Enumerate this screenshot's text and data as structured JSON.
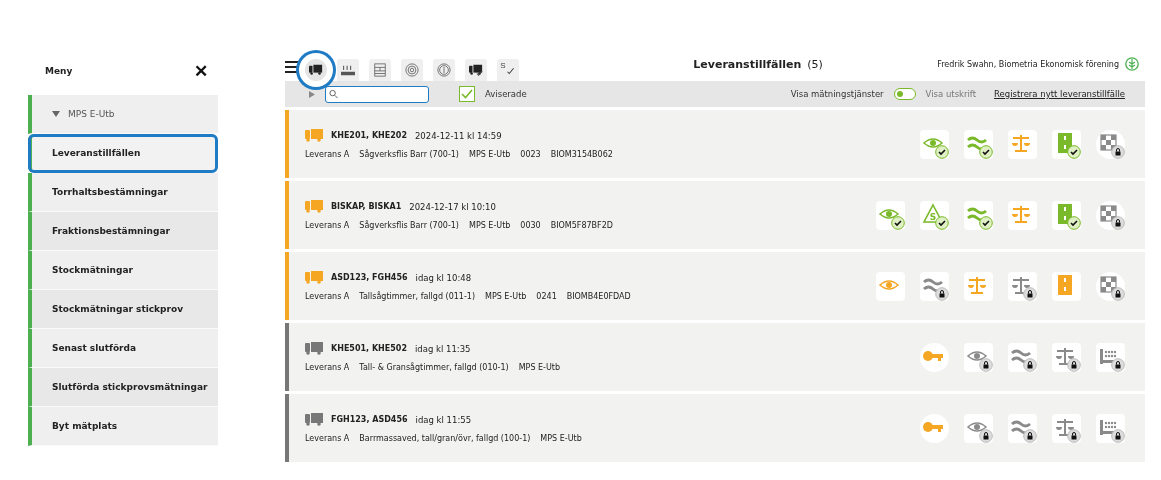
{
  "sidebar": {
    "title": "Meny",
    "close": "✕",
    "items": [
      {
        "label": "MPS E-Utb",
        "kind": "group",
        "expanded": true,
        "selected": false
      },
      {
        "label": "Leveranstillfällen",
        "kind": "link",
        "selected": true
      },
      {
        "label": "Torrhaltsbestämningar",
        "kind": "link",
        "selected": false
      },
      {
        "label": "Fraktionsbestämningar",
        "kind": "link",
        "selected": false
      },
      {
        "label": "Stockmätningar",
        "kind": "link",
        "selected": false
      },
      {
        "label": "Stockmätningar stickprov",
        "kind": "link",
        "selected": false
      },
      {
        "label": "Senast slutförda",
        "kind": "link",
        "selected": false
      },
      {
        "label": "Slutförda stickprovsmätningar",
        "kind": "link",
        "selected": false
      },
      {
        "label": "Byt mätplats",
        "kind": "link",
        "selected": false
      }
    ]
  },
  "toolbar": {
    "tabs": [
      {
        "kind": "truck",
        "selected": true
      },
      {
        "kind": "chips",
        "selected": false
      },
      {
        "kind": "table",
        "selected": false
      },
      {
        "kind": "log",
        "selected": false
      },
      {
        "kind": "coin",
        "selected": false
      },
      {
        "kind": "truckcheck",
        "selected": false
      },
      {
        "kind": "scheck",
        "label": "S",
        "selected": false
      }
    ],
    "title": "Leveranstillfällen",
    "count": "(5)",
    "user": "Fredrik Swahn, Biometria Ekonomisk förening"
  },
  "filters": {
    "aviserade": {
      "label": "Aviserade",
      "checked": true
    },
    "toggle": {
      "left": "Visa mätningstjänster",
      "right": "Visa utskrift",
      "on": false
    },
    "register": "Registrera nytt leveranstillfälle"
  },
  "rows": [
    {
      "color": "#f5a623",
      "vehicles": "KHE201, KHE202",
      "time": "2024-12-11 kl 14:59",
      "details": [
        "Leverans A",
        "Sågverksflis Barr (700-1)",
        "MPS E-Utb",
        "0023",
        "BIOM3154B062"
      ],
      "actions": [
        {
          "kind": "eye",
          "color": "#7ab929",
          "done": true,
          "locked": false
        },
        {
          "kind": "waves",
          "color": "#7ab929",
          "done": true,
          "locked": false
        },
        {
          "kind": "scale",
          "color": "#f5a623",
          "done": false,
          "locked": false
        },
        {
          "kind": "road",
          "color": "#7ab929",
          "done": true,
          "locked": false
        },
        {
          "kind": "flag",
          "color": "#8a8a8a",
          "done": false,
          "locked": true
        }
      ]
    },
    {
      "color": "#f5a623",
      "vehicles": "BISKAP, BISKA1",
      "time": "2024-12-17 kl 10:10",
      "details": [
        "Leverans A",
        "Sågverksflis Barr (700-1)",
        "MPS E-Utb",
        "0030",
        "BIOM5F87BF2D"
      ],
      "actions": [
        {
          "kind": "eye",
          "color": "#7ab929",
          "done": true,
          "locked": false
        },
        {
          "kind": "sign",
          "label": "S",
          "color": "#7ab929",
          "done": true,
          "locked": false
        },
        {
          "kind": "waves",
          "color": "#7ab929",
          "done": true,
          "locked": false
        },
        {
          "kind": "scale",
          "color": "#f5a623",
          "done": false,
          "locked": false
        },
        {
          "kind": "road",
          "color": "#7ab929",
          "done": true,
          "locked": false
        },
        {
          "kind": "flag",
          "color": "#8a8a8a",
          "done": false,
          "locked": true
        }
      ]
    },
    {
      "color": "#f5a623",
      "vehicles": "ASD123, FGH456",
      "time": "idag kl 10:48",
      "details": [
        "Leverans A",
        "Tallsågtimmer, fallgd (011-1)",
        "MPS E-Utb",
        "0241",
        "BIOMB4E0FDAD"
      ],
      "actions": [
        {
          "kind": "eye",
          "color": "#f5a623",
          "done": false,
          "locked": false
        },
        {
          "kind": "waves",
          "color": "#8a8a8a",
          "done": false,
          "locked": true
        },
        {
          "kind": "scale",
          "color": "#f5a623",
          "done": false,
          "locked": false
        },
        {
          "kind": "scale",
          "color": "#8a8a8a",
          "done": false,
          "locked": true
        },
        {
          "kind": "road",
          "color": "#f5a623",
          "done": false,
          "locked": false
        },
        {
          "kind": "flag",
          "color": "#8a8a8a",
          "done": false,
          "locked": true
        }
      ]
    },
    {
      "color": "#777777",
      "vehicles": "KHE501, KHE502",
      "time": "idag kl 11:35",
      "details": [
        "Leverans A",
        "Tall- & Gransågtimmer, fallgd (010-1)",
        "MPS E-Utb"
      ],
      "actions": [
        {
          "kind": "key",
          "color": "#f5a623",
          "done": false,
          "locked": false
        },
        {
          "kind": "eye",
          "color": "#8a8a8a",
          "done": false,
          "locked": true
        },
        {
          "kind": "waves",
          "color": "#8a8a8a",
          "done": false,
          "locked": true
        },
        {
          "kind": "scale",
          "color": "#8a8a8a",
          "done": false,
          "locked": true
        },
        {
          "kind": "crate",
          "color": "#8a8a8a",
          "done": false,
          "locked": true
        }
      ]
    },
    {
      "color": "#777777",
      "vehicles": "FGH123, ASD456",
      "time": "idag kl 11:55",
      "details": [
        "Leverans A",
        "Barrmassaved, tall/gran/övr, fallgd (100-1)",
        "MPS E-Utb"
      ],
      "actions": [
        {
          "kind": "key",
          "color": "#f5a623",
          "done": false,
          "locked": false
        },
        {
          "kind": "eye",
          "color": "#8a8a8a",
          "done": false,
          "locked": true
        },
        {
          "kind": "waves",
          "color": "#8a8a8a",
          "done": false,
          "locked": true
        },
        {
          "kind": "scale",
          "color": "#8a8a8a",
          "done": false,
          "locked": true
        },
        {
          "kind": "crate",
          "color": "#8a8a8a",
          "done": false,
          "locked": true
        }
      ]
    }
  ]
}
